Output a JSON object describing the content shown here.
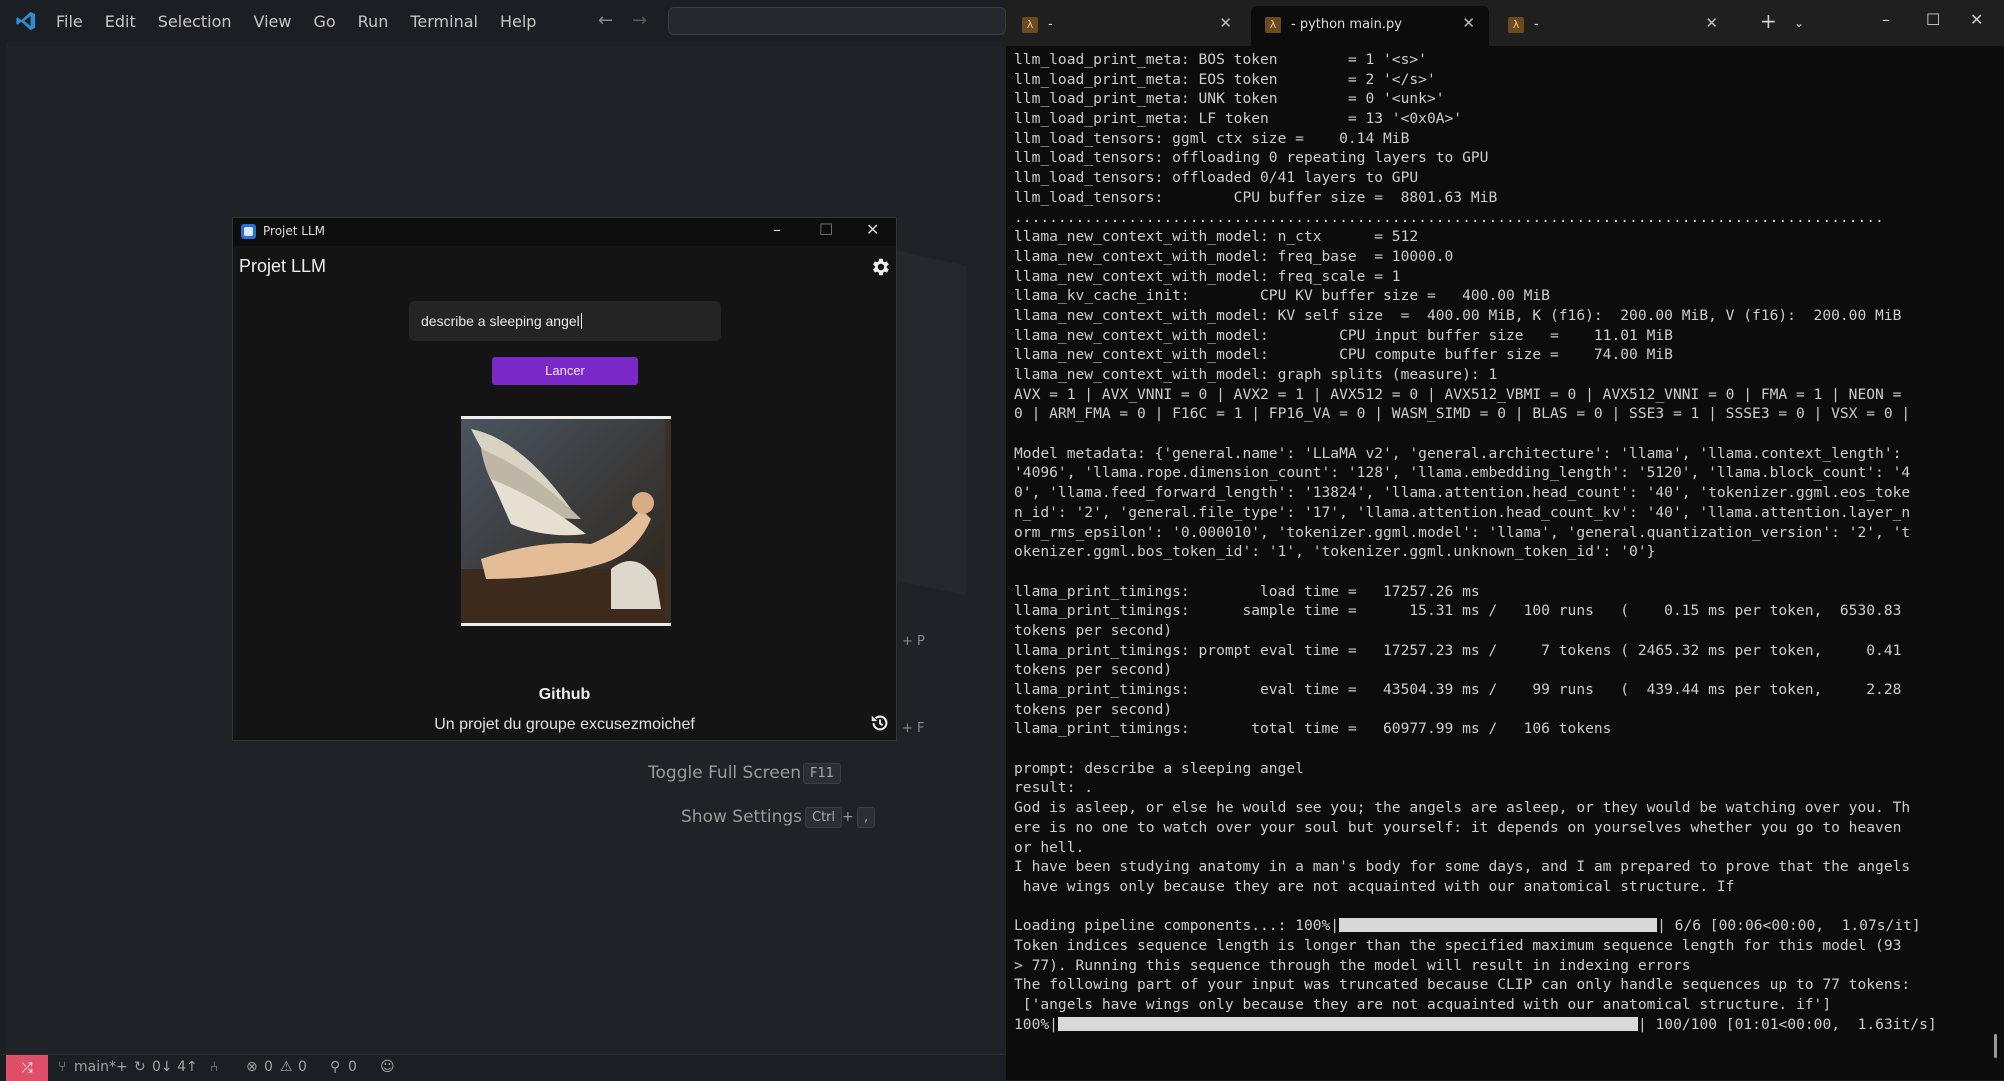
{
  "vscode": {
    "menu": [
      "File",
      "Edit",
      "Selection",
      "View",
      "Go",
      "Run",
      "Terminal",
      "Help"
    ],
    "hints": [
      {
        "label": "Toggle Full Screen",
        "keys": [
          "F11"
        ]
      },
      {
        "label": "Show Settings",
        "keys": [
          "Ctrl",
          "+",
          ","
        ]
      }
    ],
    "side_keys": [
      "+ P",
      "+ F"
    ],
    "status": {
      "branch": "main*+",
      "sync": "0↓ 4↑",
      "errors": "0",
      "warnings": "0",
      "ports": "0"
    }
  },
  "app": {
    "window_title": "Projet LLM",
    "header": "Projet LLM",
    "prompt_value": "describe a sleeping angel",
    "button_label": "Lancer",
    "footer_title": "Github",
    "footer_subtitle": "Un projet du groupe excusezmoichef"
  },
  "terminal": {
    "tabs": [
      {
        "label": "-",
        "active": false
      },
      {
        "label": "- python main.py",
        "active": true
      },
      {
        "label": "-",
        "active": false
      }
    ],
    "lines": [
      "llm_load_print_meta: BOS token        = 1 '<s>'",
      "llm_load_print_meta: EOS token        = 2 '</s>'",
      "llm_load_print_meta: UNK token        = 0 '<unk>'",
      "llm_load_print_meta: LF token         = 13 '<0x0A>'",
      "llm_load_tensors: ggml ctx size =    0.14 MiB",
      "llm_load_tensors: offloading 0 repeating layers to GPU",
      "llm_load_tensors: offloaded 0/41 layers to GPU",
      "llm_load_tensors:        CPU buffer size =  8801.63 MiB",
      "...................................................................................................",
      "llama_new_context_with_model: n_ctx      = 512",
      "llama_new_context_with_model: freq_base  = 10000.0",
      "llama_new_context_with_model: freq_scale = 1",
      "llama_kv_cache_init:        CPU KV buffer size =   400.00 MiB",
      "llama_new_context_with_model: KV self size  =  400.00 MiB, K (f16):  200.00 MiB, V (f16):  200.00 MiB",
      "llama_new_context_with_model:        CPU input buffer size   =    11.01 MiB",
      "llama_new_context_with_model:        CPU compute buffer size =    74.00 MiB",
      "llama_new_context_with_model: graph splits (measure): 1",
      "AVX = 1 | AVX_VNNI = 0 | AVX2 = 1 | AVX512 = 0 | AVX512_VBMI = 0 | AVX512_VNNI = 0 | FMA = 1 | NEON =",
      "0 | ARM_FMA = 0 | F16C = 1 | FP16_VA = 0 | WASM_SIMD = 0 | BLAS = 0 | SSE3 = 1 | SSSE3 = 0 | VSX = 0 |",
      "",
      "Model metadata: {'general.name': 'LLaMA v2', 'general.architecture': 'llama', 'llama.context_length':",
      "'4096', 'llama.rope.dimension_count': '128', 'llama.embedding_length': '5120', 'llama.block_count': '4",
      "0', 'llama.feed_forward_length': '13824', 'llama.attention.head_count': '40', 'tokenizer.ggml.eos_toke",
      "n_id': '2', 'general.file_type': '17', 'llama.attention.head_count_kv': '40', 'llama.attention.layer_n",
      "orm_rms_epsilon': '0.000010', 'tokenizer.ggml.model': 'llama', 'general.quantization_version': '2', 't",
      "okenizer.ggml.bos_token_id': '1', 'tokenizer.ggml.unknown_token_id': '0'}",
      "",
      "llama_print_timings:        load time =   17257.26 ms",
      "llama_print_timings:      sample time =      15.31 ms /   100 runs   (    0.15 ms per token,  6530.83",
      "tokens per second)",
      "llama_print_timings: prompt eval time =   17257.23 ms /     7 tokens ( 2465.32 ms per token,     0.41",
      "tokens per second)",
      "llama_print_timings:        eval time =   43504.39 ms /    99 runs   (  439.44 ms per token,     2.28",
      "tokens per second)",
      "llama_print_timings:       total time =   60977.99 ms /   106 tokens",
      "",
      "prompt: describe a sleeping angel",
      "result: .",
      "God is asleep, or else he would see you; the angels are asleep, or they would be watching over you. Th",
      "ere is no one to watch over your soul but yourself: it depends on yourselves whether you go to heaven",
      "or hell.",
      "I have been studying anatomy in a man's body for some days, and I am prepared to prove that the angels",
      " have wings only because they are not acquainted with our anatomical structure. If",
      "",
      "Token indices sequence length is longer than the specified maximum sequence length for this model (93",
      "> 77). Running this sequence through the model will result in indexing errors",
      "The following part of your input was truncated because CLIP can only handle sequences up to 77 tokens:",
      " ['angels have wings only because they are not acquainted with our anatomical structure. if']"
    ],
    "pipeline_line": {
      "prefix": "Loading pipeline components...: 100%|",
      "suffix": "| 6/6 [00:06<00:00,  1.07s/it]",
      "progress": 1.0
    },
    "final_line": {
      "prefix": "100%|",
      "suffix": "| 100/100 [01:01<00:00,  1.63it/s]",
      "progress": 1.0
    }
  }
}
